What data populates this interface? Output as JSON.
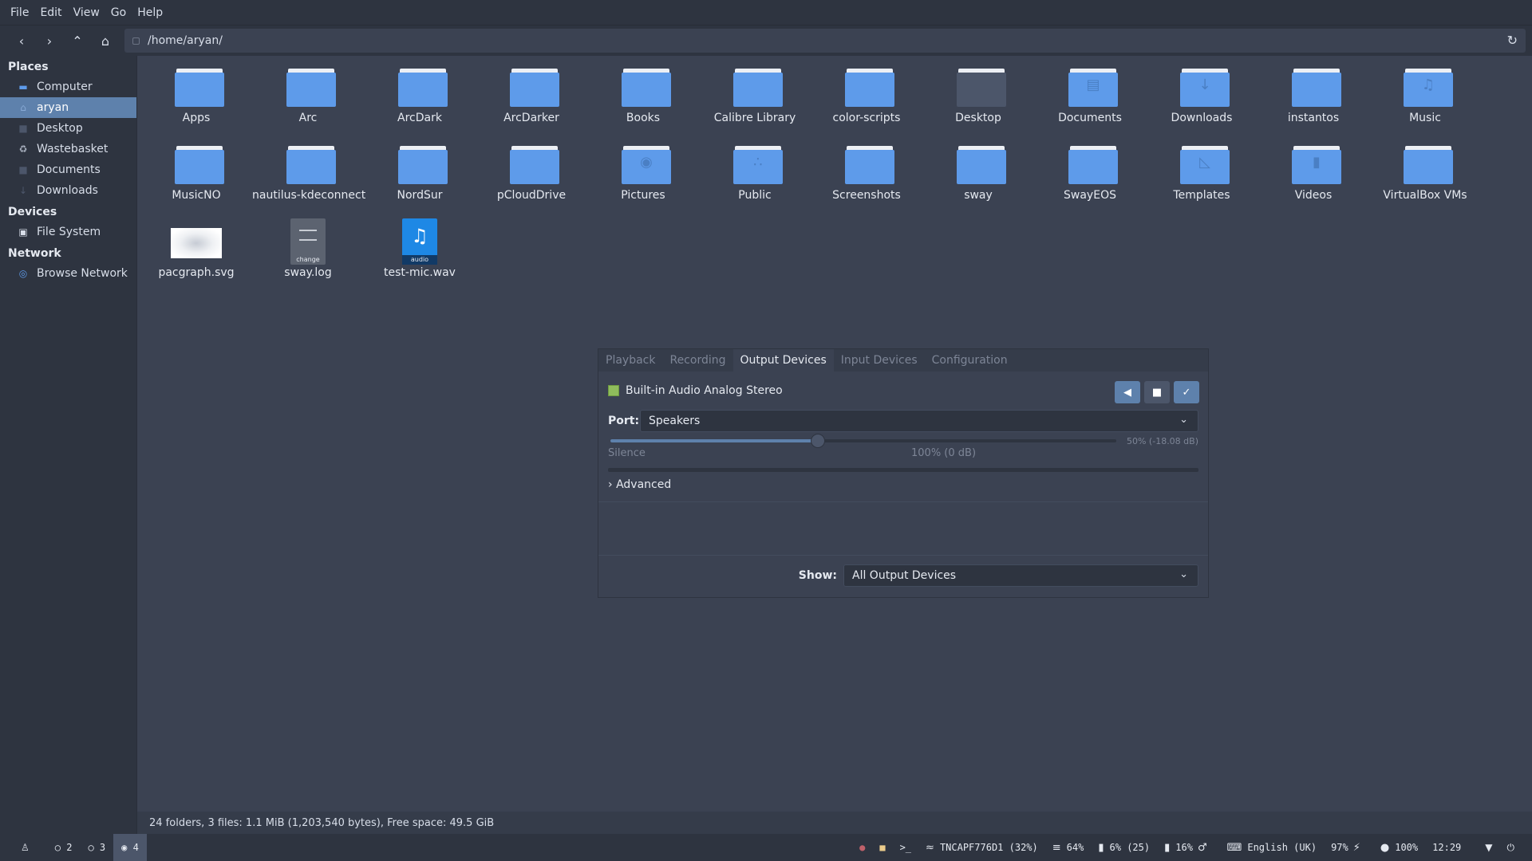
{
  "menubar": {
    "items": [
      "File",
      "Edit",
      "View",
      "Go",
      "Help"
    ]
  },
  "toolbar": {
    "path": "/home/aryan/"
  },
  "sidebar": {
    "places_header": "Places",
    "places": [
      "Computer",
      "aryan",
      "Desktop",
      "Wastebasket",
      "Documents",
      "Downloads"
    ],
    "devices_header": "Devices",
    "devices": [
      "File System"
    ],
    "network_header": "Network",
    "network": [
      "Browse Network"
    ]
  },
  "files": [
    "Apps",
    "Arc",
    "ArcDark",
    "ArcDarker",
    "Books",
    "Calibre Library",
    "color-scripts",
    "Desktop",
    "Documents",
    "Downloads",
    "instantos",
    "Music",
    "MusicNO",
    "nautilus-kdeconnect",
    "NordSur",
    "pCloudDrive",
    "Pictures",
    "Public",
    "Screenshots",
    "sway",
    "SwayEOS",
    "Templates",
    "Videos",
    "VirtualBox VMs",
    "pacgraph.svg",
    "sway.log",
    "test-mic.wav"
  ],
  "file_badges": {
    "sway_log": "change",
    "test_mic": "audio"
  },
  "pavucontrol": {
    "tabs": [
      "Playback",
      "Recording",
      "Output Devices",
      "Input Devices",
      "Configuration"
    ],
    "active_tab": "Output Devices",
    "device_name": "Built-in Audio Analog Stereo",
    "port_label": "Port:",
    "port_value": "Speakers",
    "volume": 0.5,
    "volume_text": "50% (-18.08 dB)",
    "silence_label": "Silence",
    "hundred_label": "100% (0 dB)",
    "advanced_label": "Advanced",
    "show_label": "Show:",
    "show_value": "All Output Devices"
  },
  "status": "24 folders, 3 files: 1.1 MiB (1,203,540 bytes), Free space: 49.5 GiB",
  "panel": {
    "workspaces": [
      "2",
      "3",
      "4"
    ],
    "active_workspace": "4",
    "wifi": "TNCAPF776D1 (32%)",
    "memory": "64%",
    "cpu": "6% (25)",
    "disk": "16%",
    "keyboard": "English (UK)",
    "battery": "97%",
    "brightness": "100%",
    "clock": "12:29"
  }
}
